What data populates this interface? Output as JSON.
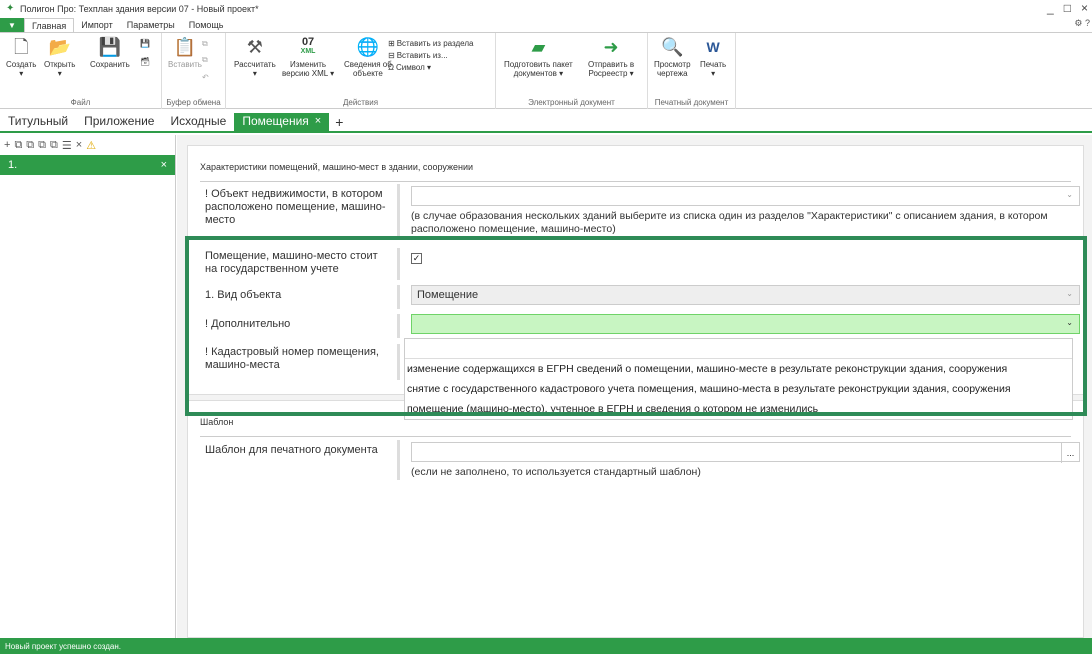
{
  "window": {
    "title": "Полигон Про: Техплан здания версии 07 - Новый проект*",
    "minimize": "_",
    "maximize": "□",
    "close": "×",
    "extra": "⚙ ?"
  },
  "menu": {
    "tabs": [
      "Главная",
      "Импорт",
      "Параметры",
      "Помощь"
    ]
  },
  "ribbon": {
    "file": {
      "label": "Файл",
      "create": "Создать",
      "open": "Открыть",
      "save": "Сохранить"
    },
    "clipboard": {
      "label": "Буфер обмена",
      "paste": "Вставить"
    },
    "actions": {
      "label": "Действия",
      "calculate": "Рассчитать",
      "xml_line1": "07",
      "xml_line2": "XML",
      "change_xml_1": "Изменить",
      "change_xml_2": "версию XML ▾",
      "object_info_1": "Сведения об",
      "object_info_2": "объекте",
      "insert_section": "Вставить из раздела",
      "insert_from": "Вставить из...",
      "symbol": "Символ ▾"
    },
    "edoc": {
      "label": "Электронный документ",
      "prepare_1": "Подготовить пакет",
      "prepare_2": "документов ▾",
      "send_1": "Отправить в",
      "send_2": "Росреестр ▾"
    },
    "print": {
      "label": "Печатный документ",
      "preview_1": "Просмотр",
      "preview_2": "чертежа",
      "print": "Печать"
    }
  },
  "doc_tabs": [
    "Титульный",
    "Приложение",
    "Исходные",
    "Помещения"
  ],
  "doc_tab_close": "×",
  "doc_tab_add": "+",
  "left_panel": {
    "item": "1.",
    "item_close": "×"
  },
  "section": {
    "title": "Характеристики помещений, машино-мест в здании, сооружении",
    "realty_label": "! Объект недвижимости, в котором расположено помещение, машино-место",
    "realty_hint": "(в случае образования нескольких зданий выберите из списка один из разделов \"Характеристики\" с описанием здания, в котором расположено помещение, машино-место)",
    "registered_label": "Помещение, машино-место стоит на государственном учете",
    "registered_check": "✓",
    "kind_label": "1. Вид объекта",
    "kind_value": "Помещение",
    "extra_label": "! Дополнительно",
    "cadastral_label": "! Кадастровый номер помещения, машино-места",
    "dropdown_options": [
      "изменение содержащихся в ЕГРН сведений о помещении, машино-месте в результате реконструкции здания, сооружения",
      "снятие с государственного кадастрового учета помещения, машино-места в результате реконструкции здания, сооружения",
      "помещение (машино-место), учтенное в ЕГРН и сведения о котором не изменились"
    ]
  },
  "template_section": {
    "title": "Шаблон",
    "label": "Шаблон для печатного документа",
    "dots": "...",
    "hint": "(если не заполнено, то используется стандартный шаблон)"
  },
  "status": "Новый проект успешно создан."
}
